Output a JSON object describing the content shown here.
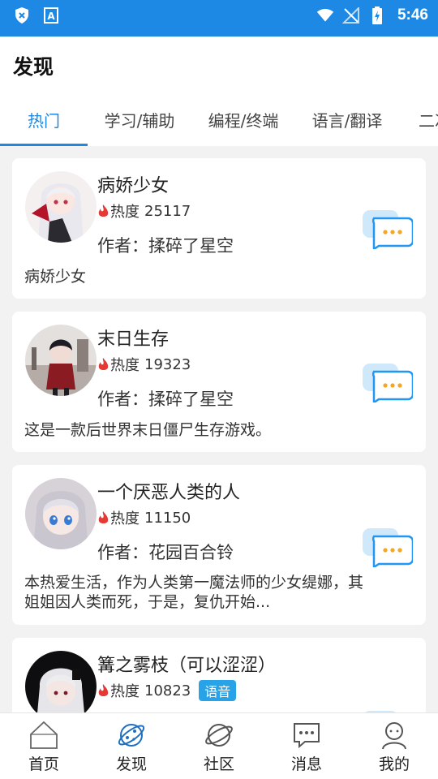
{
  "status_bar": {
    "time": "5:46",
    "icons": [
      "shield-x-icon",
      "a-icon",
      "wifi-icon",
      "no-signal-icon",
      "battery-charging-icon"
    ]
  },
  "header": {
    "title": "发现",
    "tabs": [
      {
        "label": "热门",
        "active": true
      },
      {
        "label": "学习/辅助"
      },
      {
        "label": "编程/终端"
      },
      {
        "label": "语言/翻译"
      },
      {
        "label": "二次"
      }
    ]
  },
  "cards": [
    {
      "name": "病娇少女",
      "heat_label": "热度",
      "heat": "25117",
      "author": "作者：揉碎了星空",
      "desc": "病娇少女",
      "avatar": "girl-white-hair-fan-avatar"
    },
    {
      "name": "末日生存",
      "heat_label": "热度",
      "heat": "19323",
      "author": "作者：揉碎了星空",
      "desc": "这是一款后世界末日僵尸生存游戏。",
      "avatar": "girl-city-ruins-avatar"
    },
    {
      "name": "一个厌恶人类的人",
      "heat_label": "热度",
      "heat": "11150",
      "author": "作者：花园百合铃",
      "desc": "本热爱生活，作为人类第一魔法师的少女缇娜，其姐姐因人类而死，于是，复仇开始...",
      "avatar": "girl-silver-hair-blue-eyes-avatar"
    },
    {
      "name": "篝之雾枝（可以涩涩）",
      "heat_label": "热度",
      "heat": "10823",
      "tag": "语音",
      "avatar": "girl-black-background-avatar"
    }
  ],
  "bottom_nav": [
    {
      "label": "首页",
      "icon": "home-icon"
    },
    {
      "label": "发现",
      "icon": "planet-icon",
      "active": true
    },
    {
      "label": "社区",
      "icon": "community-planet-icon"
    },
    {
      "label": "消息",
      "icon": "message-icon"
    },
    {
      "label": "我的",
      "icon": "profile-icon"
    }
  ],
  "colors": {
    "accent": "#1e88e5",
    "tag": "#29a3e8",
    "flame": "#e53935",
    "chat_bubble": "#2196f3"
  }
}
